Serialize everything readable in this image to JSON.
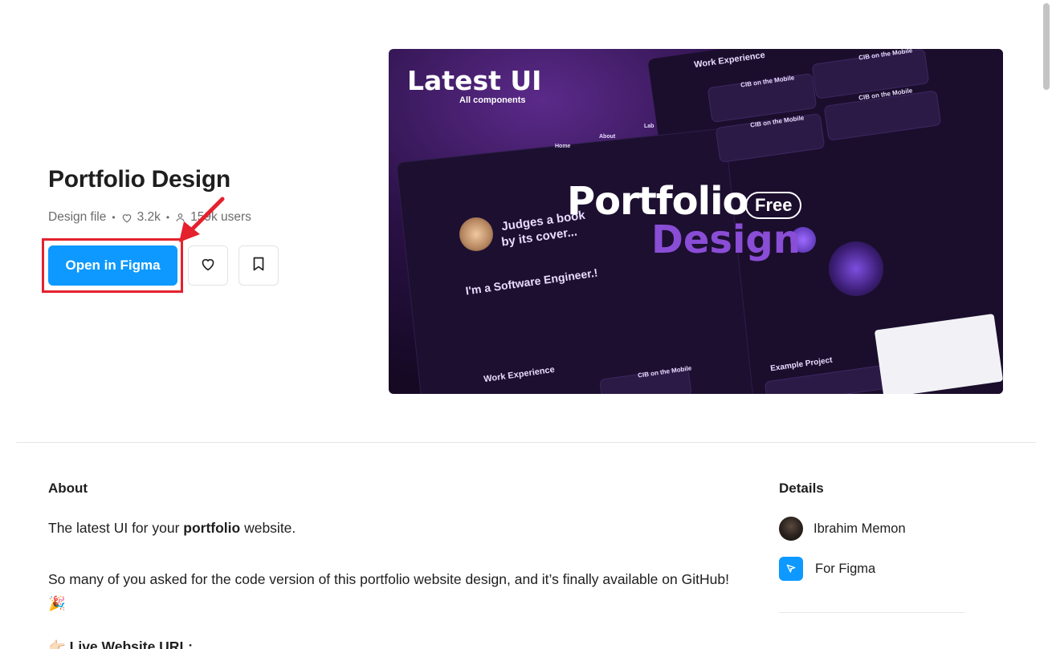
{
  "hero": {
    "title": "Portfolio Design",
    "meta": {
      "type": "Design file",
      "likes": "3.2k",
      "users": "159k users"
    },
    "open_button": "Open in Figma"
  },
  "preview": {
    "latest": "Latest UI",
    "all_components": "All components",
    "portfolio": "Portfolio",
    "free": "Free",
    "design": "Design",
    "software_engineer": "I'm a Software Engineer.!",
    "judges": "Judges a book",
    "by_its": "by its cover...",
    "work_experience": "Work Experience",
    "cib": "CIB on the Mobile",
    "example_project": "Example Project",
    "home": "Home",
    "about": "About",
    "lab": "Lab"
  },
  "about": {
    "heading": "About",
    "p1_pre": "The latest UI for your ",
    "p1_bold": "portfolio",
    "p1_post": " website.",
    "p2": "So many of you asked for the code version of this portfolio website design, and it’s finally available on GitHub! 🎉",
    "p3": "👉🏻 Live Website URL:"
  },
  "details": {
    "heading": "Details",
    "author": "Ibrahim Memon",
    "platform": "For Figma"
  },
  "colors": {
    "accent": "#0d99ff",
    "highlight": "#e5212e",
    "text": "#1e1e1e",
    "muted": "#6b6b6b"
  }
}
